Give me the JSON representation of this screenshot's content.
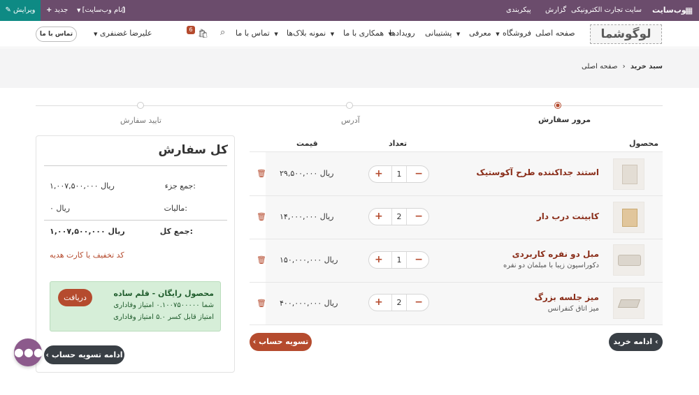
{
  "topbar": {
    "brand": "وب‌سایت",
    "menu": [
      "سایت",
      "تجارت الکترونیکی",
      "گزارش",
      "پیکربندی"
    ],
    "website_selector": "[نام وب‌سایت]",
    "new_label": "جدید",
    "edit_label": "ویرایش",
    "colors": {
      "bar": "#6b4c6c",
      "edit": "#0e8a84"
    }
  },
  "navbar": {
    "logo_text": "لوگوشما",
    "items": [
      {
        "label": "صفحه اصلی",
        "dropdown": false
      },
      {
        "label": "فروشگاه",
        "dropdown": false
      },
      {
        "label": "معرفی",
        "dropdown": true
      },
      {
        "label": "پشتیبانی",
        "dropdown": true
      },
      {
        "label": "رویدادها",
        "dropdown": false
      },
      {
        "label": "همکاری با ما",
        "dropdown": true
      },
      {
        "label": "نمونه بلاک‌ها",
        "dropdown": true
      },
      {
        "label": "تماس با ما",
        "dropdown": true
      }
    ],
    "cart_count": "6",
    "user_name": "علیرضا غضنفری",
    "contact_button": "تماس با ما"
  },
  "breadcrumb": {
    "home": "صفحه اصلی",
    "current": "سبد خرید"
  },
  "steps": [
    {
      "label": "مرور سفارش",
      "active": true
    },
    {
      "label": "آدرس",
      "active": false
    },
    {
      "label": "تایید سفارش",
      "active": false
    }
  ],
  "table": {
    "headers": {
      "product": "محصول",
      "quantity": "تعداد",
      "price": "قیمت"
    },
    "rows": [
      {
        "name": "استند جداکننده طرح آکوستیک",
        "subtitle": "",
        "qty": "1",
        "price": "۲۹,۵۰۰,۰۰۰ ریال"
      },
      {
        "name": "کابینت درب دار",
        "subtitle": "",
        "qty": "2",
        "price": "۱۴,۰۰۰,۰۰۰ ریال"
      },
      {
        "name": "مبل دو نفره کاربردی",
        "subtitle": "دکوراسیون زیبا با مبلمان دو نفره",
        "qty": "1",
        "price": "۱۵۰,۰۰۰,۰۰۰ ریال"
      },
      {
        "name": "میز جلسه بزرگ",
        "subtitle": "میز اتاق کنفرانس",
        "qty": "2",
        "price": "۴۰۰,۰۰۰,۰۰۰ ریال"
      }
    ]
  },
  "actions": {
    "continue_shopping": "ادامه خرید",
    "checkout": "تسویه حساب"
  },
  "summary": {
    "title": "کل سفارش",
    "subtotal_label": "جمع جزء:",
    "subtotal_value": "۱,۰۰۷,۵۰۰,۰۰۰ ریال",
    "tax_label": "مالیات:",
    "tax_value": "۰ ریال",
    "total_label": "جمع کل:",
    "total_value": "۱,۰۰۷,۵۰۰,۰۰۰ ریال",
    "coupon_link": "کد تخفیف یا کارت هدیه",
    "loyalty": {
      "title": "محصول رایگان - قلم ساده",
      "line1": "شما ۰.۱۰۰۷۵۰۰۰۰۰ امتیاز وفاداری",
      "line2": "امتیاز قابل کسر ۵.۰ امتیاز وفاداری",
      "claim_button": "دریافت"
    },
    "continue_checkout": "ادامه تسویه حساب"
  },
  "colors": {
    "accent": "#b54b2e",
    "product_name": "#8a2e1a",
    "loyalty_bg": "#d6eed8",
    "chat": "#8c5a8c"
  }
}
